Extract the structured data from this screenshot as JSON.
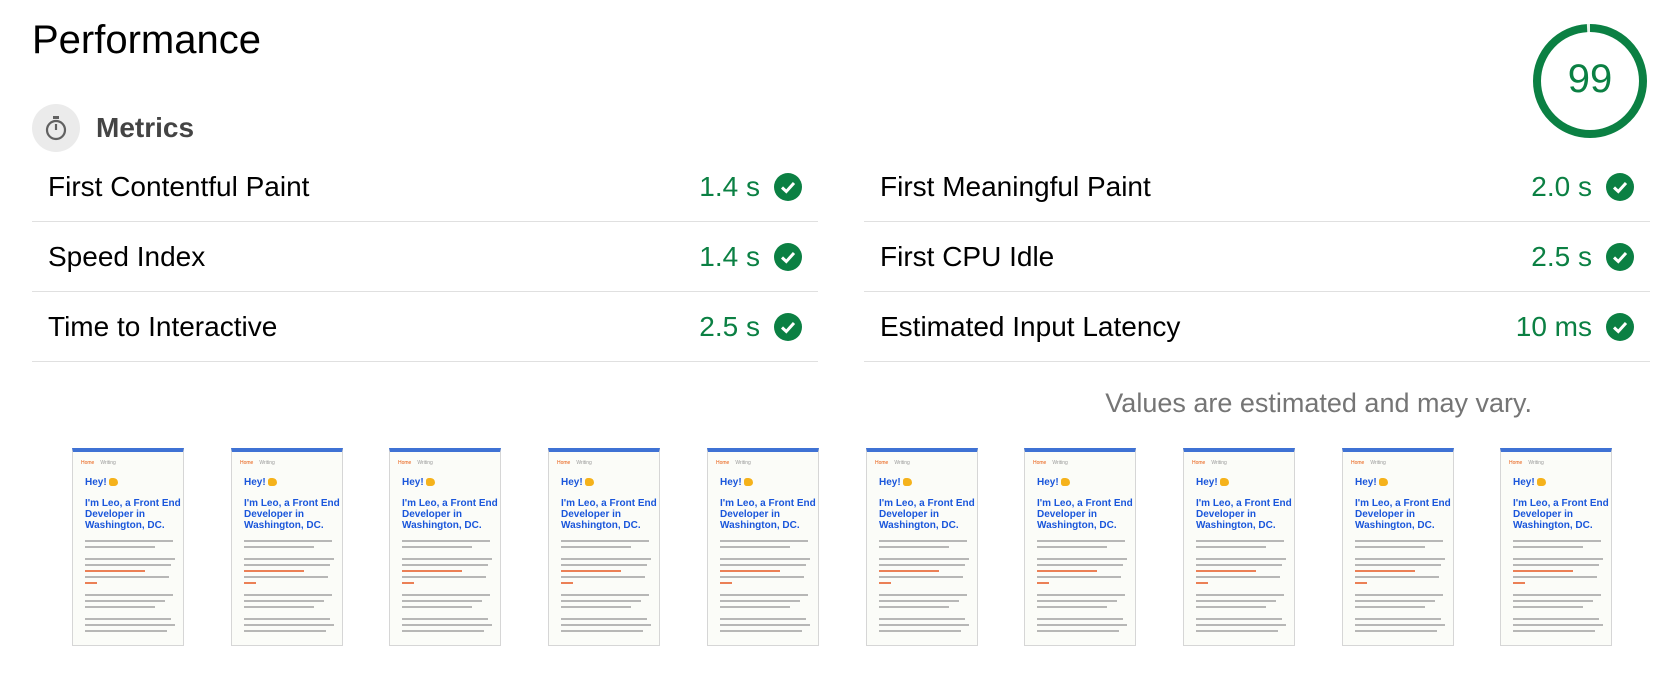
{
  "section_title": "Performance",
  "score": "99",
  "score_fraction": 0.99,
  "colors": {
    "pass": "#0b8043",
    "accent": "#1a73e8"
  },
  "metrics_header": {
    "label": "Metrics",
    "icon": "stopwatch-icon"
  },
  "metrics_left": [
    {
      "name": "First Contentful Paint",
      "value": "1.4 s",
      "status": "pass"
    },
    {
      "name": "Speed Index",
      "value": "1.4 s",
      "status": "pass"
    },
    {
      "name": "Time to Interactive",
      "value": "2.5 s",
      "status": "pass"
    }
  ],
  "metrics_right": [
    {
      "name": "First Meaningful Paint",
      "value": "2.0 s",
      "status": "pass"
    },
    {
      "name": "First CPU Idle",
      "value": "2.5 s",
      "status": "pass"
    },
    {
      "name": "Estimated Input Latency",
      "value": "10 ms",
      "status": "pass"
    }
  ],
  "disclaimer": "Values are estimated and may vary.",
  "filmstrip": {
    "frame_count": 10,
    "nav_links": [
      "Home",
      "Writing"
    ],
    "greeting": "Hey!",
    "intro": "I'm Leo, a Front End Developer in Washington, DC."
  }
}
